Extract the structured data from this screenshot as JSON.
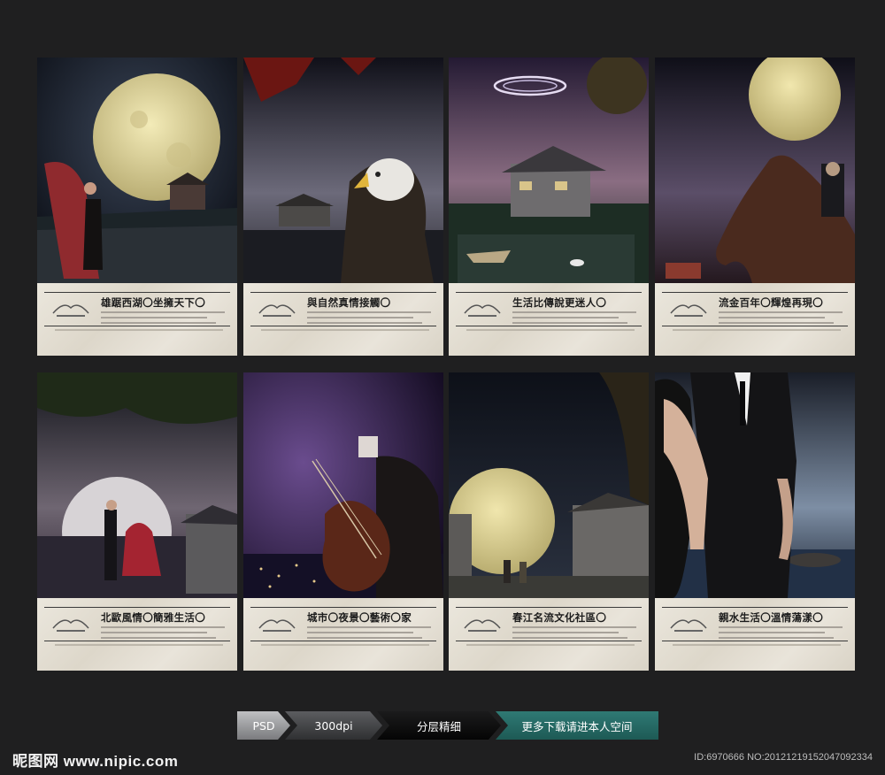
{
  "cards": [
    {
      "slogan": "雄踞西湖〇坐擁天下〇"
    },
    {
      "slogan": "與自然真情接觸〇"
    },
    {
      "slogan": "生活比傳說更迷人〇"
    },
    {
      "slogan": "流金百年〇輝煌再現〇"
    },
    {
      "slogan": "北歐風情〇簡雅生活〇"
    },
    {
      "slogan": "城市〇夜景〇藝術〇家"
    },
    {
      "slogan": "春江名流文化社區〇"
    },
    {
      "slogan": "親水生活〇溫情蕩漾〇"
    }
  ],
  "tags": {
    "psd": "PSD",
    "dpi": "300dpi",
    "layers": "分层精细",
    "more": "更多下载请进本人空间"
  },
  "watermark": "昵图网 www.nipic.com",
  "id_line": "ID:6970666 NO:20121219152047092334",
  "colors": {
    "background": "#1f1f20",
    "panel": "#e6e1d6",
    "moon": "#e9dfa3",
    "teal_tag": "#2f7a74"
  }
}
